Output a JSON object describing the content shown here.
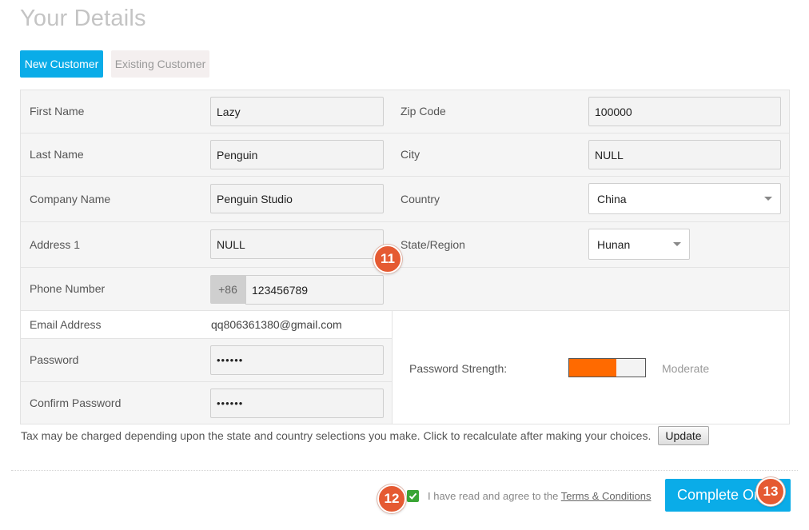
{
  "page_title": "Your Details",
  "tabs": [
    {
      "label": "New Customer",
      "active": true
    },
    {
      "label": "Existing Customer",
      "active": false
    }
  ],
  "form": {
    "first_name": {
      "label": "First Name",
      "value": "Lazy"
    },
    "last_name": {
      "label": "Last Name",
      "value": "Penguin"
    },
    "company_name": {
      "label": "Company Name",
      "value": "Penguin Studio"
    },
    "address1": {
      "label": "Address 1",
      "value": "NULL"
    },
    "phone": {
      "label": "Phone Number",
      "prefix": "+86",
      "value": "123456789"
    },
    "zip": {
      "label": "Zip Code",
      "value": "100000"
    },
    "city": {
      "label": "City",
      "value": "NULL"
    },
    "country": {
      "label": "Country",
      "value": "China"
    },
    "state": {
      "label": "State/Region",
      "value": "Hunan"
    },
    "email": {
      "label": "Email Address",
      "value": "qq806361380@gmail.com"
    },
    "password": {
      "label": "Password",
      "value": "••••••"
    },
    "confirm_password": {
      "label": "Confirm Password",
      "value": "••••••"
    },
    "password_strength": {
      "label": "Password Strength:",
      "text": "Moderate",
      "level": 0.62,
      "color": "#ff6a00"
    }
  },
  "tax_note": "Tax may be charged depending upon the state and country selections you make. Click to recalculate after making your choices.",
  "update_label": "Update",
  "agree": {
    "text": "I have read and agree to the ",
    "link": "Terms & Conditions",
    "checked": true
  },
  "complete_button": "Complete Or",
  "badges": [
    "11",
    "12",
    "13"
  ],
  "colors": {
    "accent": "#0aace8",
    "badge": "#e55a32",
    "check": "#3aa535"
  }
}
